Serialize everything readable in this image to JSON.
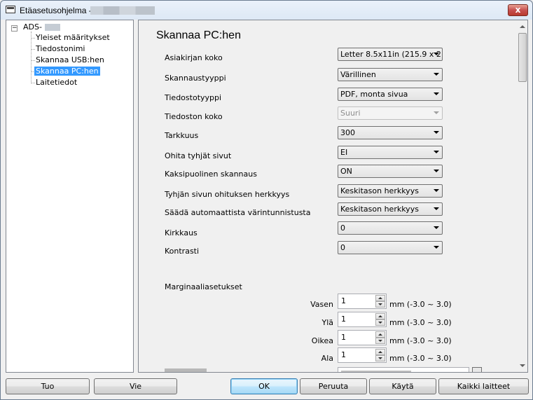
{
  "window": {
    "title": "Etäasetusohjelma -",
    "close_label": "x"
  },
  "tree": {
    "root_label": "ADS-",
    "expander": "−",
    "items": [
      {
        "label": "Yleiset määritykset",
        "selected": false
      },
      {
        "label": "Tiedostonimi",
        "selected": false
      },
      {
        "label": "Skannaa USB:hen",
        "selected": false
      },
      {
        "label": "Skannaa PC:hen",
        "selected": true
      },
      {
        "label": "Laitetiedot",
        "selected": false
      }
    ]
  },
  "content": {
    "heading": "Skannaa PC:hen",
    "settings": [
      {
        "label": "Asiakirjan koko",
        "value": "Letter 8.5x11in (215.9 x 2",
        "enabled": true
      },
      {
        "label": "Skannaustyyppi",
        "value": "Värillinen",
        "enabled": true
      },
      {
        "label": "Tiedostotyyppi",
        "value": "PDF, monta sivua",
        "enabled": true
      },
      {
        "label": "Tiedoston koko",
        "value": "Suuri",
        "enabled": false
      },
      {
        "label": "Tarkkuus",
        "value": "300",
        "enabled": true
      },
      {
        "label": "Ohita tyhjät sivut",
        "value": "EI",
        "enabled": true
      },
      {
        "label": "Kaksipuolinen skannaus",
        "value": "ON",
        "enabled": true
      },
      {
        "label": "Tyhjän sivun ohituksen herkkyys",
        "value": "Keskitason herkkyys",
        "enabled": true
      },
      {
        "label": "Säädä automaattista värintunnistusta",
        "value": "Keskitason herkkyys",
        "enabled": true
      },
      {
        "label": "Kirkkaus",
        "value": "0",
        "enabled": true
      },
      {
        "label": "Kontrasti",
        "value": "0",
        "enabled": true
      }
    ],
    "margins": {
      "heading": "Marginaaliasetukset",
      "unit": "mm (-3.0 ~ 3.0)",
      "items": [
        {
          "label": "Vasen",
          "value": "1"
        },
        {
          "label": "Ylä",
          "value": "1"
        },
        {
          "label": "Oikea",
          "value": "1"
        },
        {
          "label": "Ala",
          "value": "1"
        }
      ]
    }
  },
  "buttons": {
    "import": "Tuo",
    "export": "Vie",
    "ok": "OK",
    "cancel": "Peruuta",
    "apply": "Käytä",
    "all_devices": "Kaikki laitteet"
  }
}
